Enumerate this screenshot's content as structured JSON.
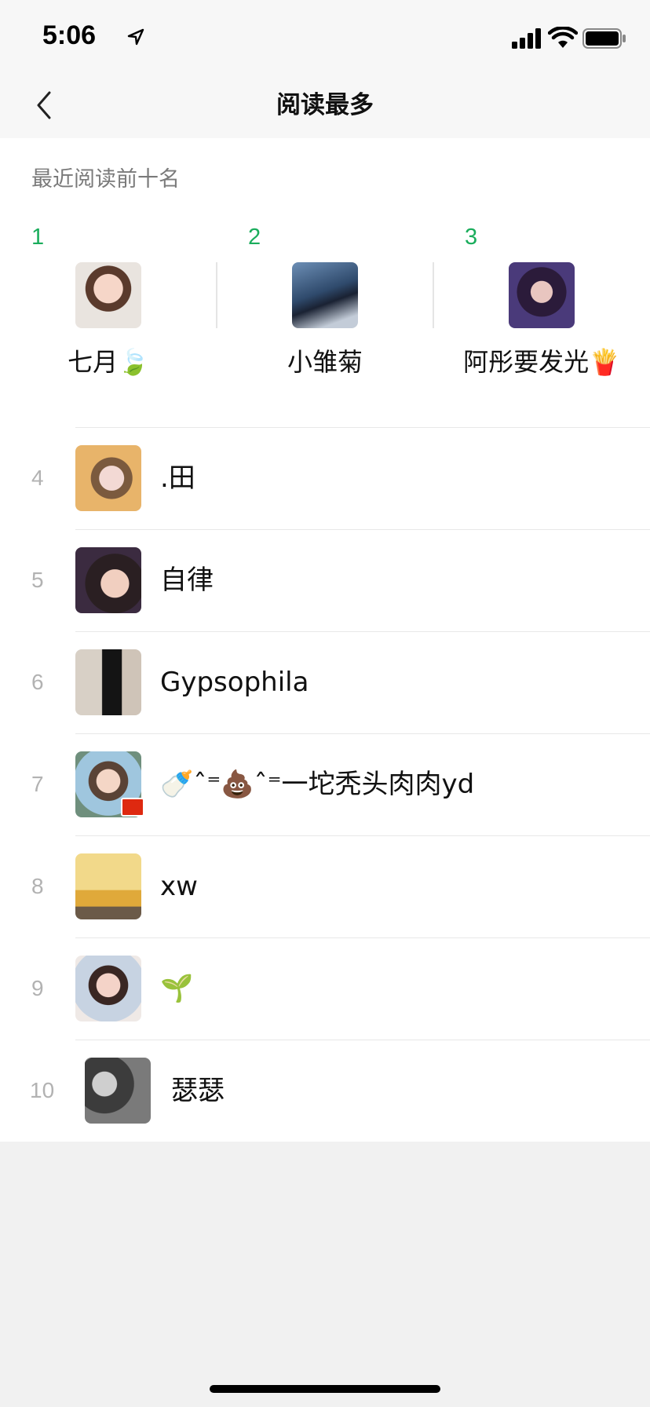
{
  "status_bar": {
    "time": "5:06"
  },
  "nav": {
    "title": "阅读最多",
    "back_icon": "chevron-left-icon"
  },
  "section": {
    "label": "最近阅读前十名"
  },
  "top_three": [
    {
      "rank": "1",
      "name": "七月🍃"
    },
    {
      "rank": "2",
      "name": "小雏菊"
    },
    {
      "rank": "3",
      "name": "阿彤要发光🍟"
    }
  ],
  "list": [
    {
      "rank": "4",
      "name": ".田"
    },
    {
      "rank": "5",
      "name": "自律"
    },
    {
      "rank": "6",
      "name": "Gypsophila"
    },
    {
      "rank": "7",
      "name": "🍼ˆ⁼💩ˆ⁼一坨秃头肉肉yd"
    },
    {
      "rank": "8",
      "name": "xw"
    },
    {
      "rank": "9",
      "name": "🌱"
    },
    {
      "rank": "10",
      "name": "瑟瑟"
    }
  ],
  "colors": {
    "accent": "#1aad5c",
    "rank_muted": "#b2b2b2",
    "background": "#f1f1f1"
  }
}
